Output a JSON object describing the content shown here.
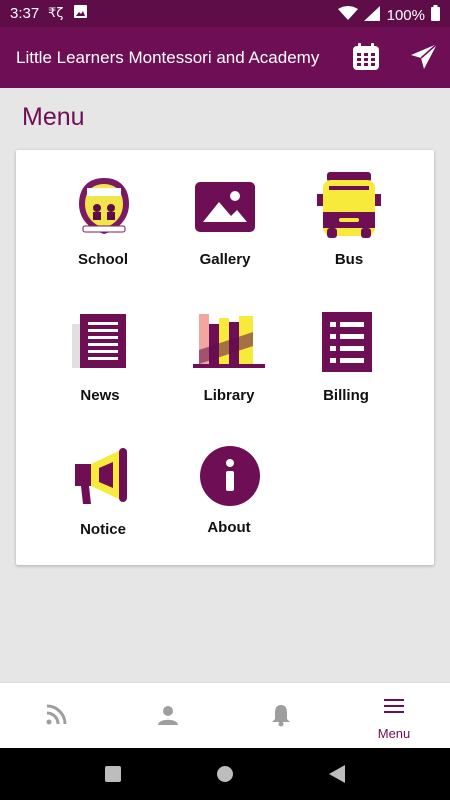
{
  "status_bar": {
    "time": "3:37",
    "battery": "100%",
    "left_icons": [
      "app-notification-icon",
      "image-icon"
    ],
    "right_icons": [
      "wifi-icon",
      "signal-icon",
      "battery-icon"
    ]
  },
  "app_bar": {
    "title": "Little Learners Montessori and Academy",
    "actions": [
      "calendar-icon",
      "send-icon"
    ]
  },
  "page": {
    "title": "Menu"
  },
  "menu": {
    "items": [
      {
        "label": "School",
        "icon": "school-logo"
      },
      {
        "label": "Gallery",
        "icon": "gallery-icon"
      },
      {
        "label": "Bus",
        "icon": "bus-icon"
      },
      {
        "label": "News",
        "icon": "news-icon"
      },
      {
        "label": "Library",
        "icon": "library-icon"
      },
      {
        "label": "Billing",
        "icon": "billing-icon"
      },
      {
        "label": "Notice",
        "icon": "megaphone-icon"
      },
      {
        "label": "About",
        "icon": "info-icon"
      }
    ]
  },
  "bottom_nav": {
    "items": [
      {
        "icon": "rss-feed-icon",
        "label": ""
      },
      {
        "icon": "profile-icon",
        "label": ""
      },
      {
        "icon": "bell-icon",
        "label": ""
      },
      {
        "icon": "menu-icon",
        "label": "Menu",
        "active": true
      }
    ]
  },
  "colors": {
    "primary": "#6e0f56",
    "status_bar": "#5e0d49",
    "accent_yellow": "#f7ea3a",
    "background": "#e6e6e6"
  }
}
